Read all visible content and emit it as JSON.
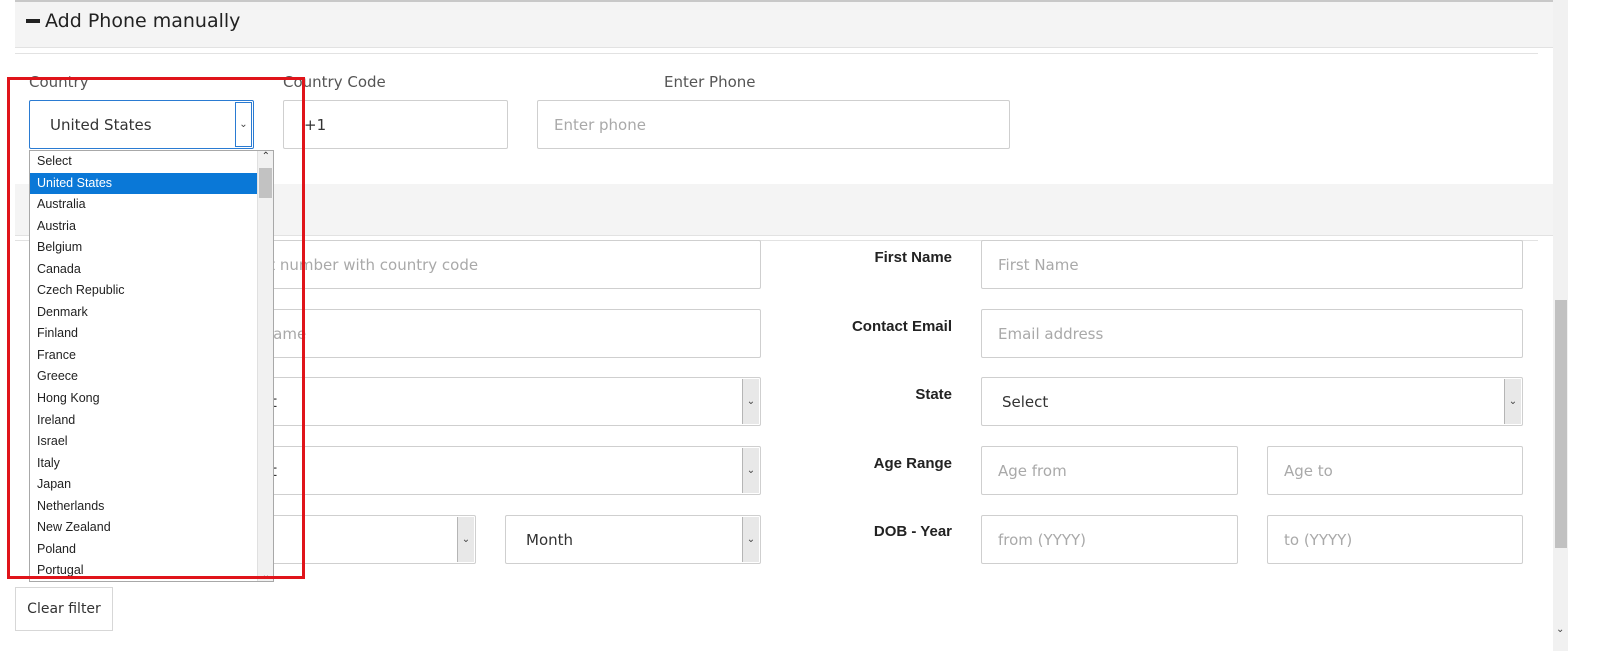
{
  "section": {
    "title": "Add Phone manually"
  },
  "phone_form": {
    "country_label": "Country",
    "country_value": "United States",
    "code_label": "Country Code",
    "code_value": "+1",
    "phone_label": "Enter Phone",
    "phone_placeholder": "Enter phone"
  },
  "country_options": [
    "Select",
    "United States",
    "Australia",
    "Austria",
    "Belgium",
    "Canada",
    "Czech Republic",
    "Denmark",
    "Finland",
    "France",
    "Greece",
    "Hong Kong",
    "Ireland",
    "Israel",
    "Italy",
    "Japan",
    "Netherlands",
    "New Zealand",
    "Poland",
    "Portugal"
  ],
  "selected_option_index": 1,
  "filters": {
    "contact_number_placeholder": "ct number with country code",
    "name_placeholder_partial": "lame",
    "select_partial_1": "t",
    "select_partial_2": "t",
    "month_value": "Month",
    "first_name_label": "First Name",
    "first_name_placeholder": "First Name",
    "email_label": "Contact Email",
    "email_placeholder": "Email address",
    "state_label": "State",
    "state_value": "Select",
    "age_label": "Age Range",
    "age_from_placeholder": "Age from",
    "age_to_placeholder": "Age to",
    "dob_label": "DOB - Year",
    "dob_from_placeholder": "from (YYYY)",
    "dob_to_placeholder": "to (YYYY)"
  },
  "buttons": {
    "clear_filter": "Clear filter"
  },
  "colors": {
    "highlight": "#e0141a",
    "selected": "#0a78d7"
  }
}
